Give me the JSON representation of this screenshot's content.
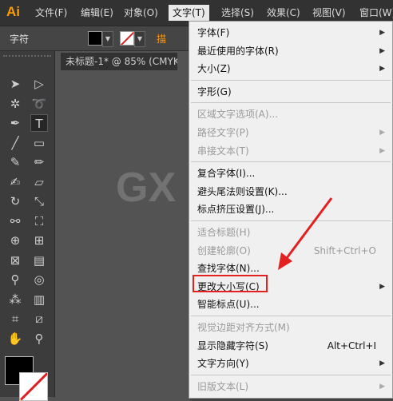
{
  "app": {
    "logo": "Ai"
  },
  "menubar": [
    {
      "label": "文件(F)",
      "active": false
    },
    {
      "label": "编辑(E)",
      "active": false
    },
    {
      "label": "对象(O)",
      "active": false
    },
    {
      "label": "文字(T)",
      "active": true
    },
    {
      "label": "选择(S)",
      "active": false
    },
    {
      "label": "效果(C)",
      "active": false
    },
    {
      "label": "视图(V)",
      "active": false
    },
    {
      "label": "窗口(W)",
      "active": false
    }
  ],
  "control_bar": {
    "label": "字符",
    "extra": "描"
  },
  "document": {
    "tab_title": "未标题-1* @ 85% (CMYK"
  },
  "watermark": "GX",
  "colors": {
    "accent": "#ff9a00",
    "highlight": "#e32121",
    "menu_bg": "#f0f0f0"
  },
  "type_menu": {
    "items": [
      {
        "label": "字体(F)",
        "shortcut": "",
        "submenu": true,
        "disabled": false,
        "sep_before": false
      },
      {
        "label": "最近使用的字体(R)",
        "shortcut": "",
        "submenu": true,
        "disabled": false,
        "sep_before": false
      },
      {
        "label": "大小(Z)",
        "shortcut": "",
        "submenu": true,
        "disabled": false,
        "sep_before": false
      },
      {
        "label": "字形(G)",
        "shortcut": "",
        "submenu": false,
        "disabled": false,
        "sep_before": true
      },
      {
        "label": "区域文字选项(A)...",
        "shortcut": "",
        "submenu": false,
        "disabled": true,
        "sep_before": true
      },
      {
        "label": "路径文字(P)",
        "shortcut": "",
        "submenu": true,
        "disabled": true,
        "sep_before": false
      },
      {
        "label": "串接文本(T)",
        "shortcut": "",
        "submenu": true,
        "disabled": true,
        "sep_before": false
      },
      {
        "label": "复合字体(I)...",
        "shortcut": "",
        "submenu": false,
        "disabled": false,
        "sep_before": true
      },
      {
        "label": "避头尾法则设置(K)...",
        "shortcut": "",
        "submenu": false,
        "disabled": false,
        "sep_before": false
      },
      {
        "label": "标点挤压设置(J)...",
        "shortcut": "",
        "submenu": false,
        "disabled": false,
        "sep_before": false
      },
      {
        "label": "适合标题(H)",
        "shortcut": "",
        "submenu": false,
        "disabled": true,
        "sep_before": true
      },
      {
        "label": "创建轮廓(O)",
        "shortcut": "Shift+Ctrl+O",
        "submenu": false,
        "disabled": true,
        "sep_before": false
      },
      {
        "label": "查找字体(N)...",
        "shortcut": "",
        "submenu": false,
        "disabled": false,
        "sep_before": false
      },
      {
        "label": "更改大小写(C)",
        "shortcut": "",
        "submenu": true,
        "disabled": false,
        "sep_before": false
      },
      {
        "label": "智能标点(U)...",
        "shortcut": "",
        "submenu": false,
        "disabled": false,
        "sep_before": false
      },
      {
        "label": "视觉边距对齐方式(M)",
        "shortcut": "",
        "submenu": false,
        "disabled": true,
        "sep_before": true
      },
      {
        "label": "显示隐藏字符(S)",
        "shortcut": "Alt+Ctrl+I",
        "submenu": false,
        "disabled": false,
        "sep_before": false
      },
      {
        "label": "文字方向(Y)",
        "shortcut": "",
        "submenu": true,
        "disabled": false,
        "sep_before": false
      },
      {
        "label": "旧版文本(L)",
        "shortcut": "",
        "submenu": true,
        "disabled": true,
        "sep_before": true
      }
    ]
  },
  "tools": [
    {
      "icon": "selection-tool-icon",
      "glyph": "➤",
      "selected": false
    },
    {
      "icon": "direct-selection-tool-icon",
      "glyph": "▷",
      "selected": false
    },
    {
      "icon": "magic-wand-tool-icon",
      "glyph": "✲",
      "selected": false
    },
    {
      "icon": "lasso-tool-icon",
      "glyph": "➰",
      "selected": false
    },
    {
      "icon": "pen-tool-icon",
      "glyph": "✒",
      "selected": false
    },
    {
      "icon": "type-tool-icon",
      "glyph": "T",
      "selected": true
    },
    {
      "icon": "line-tool-icon",
      "glyph": "╱",
      "selected": false
    },
    {
      "icon": "rectangle-tool-icon",
      "glyph": "▭",
      "selected": false
    },
    {
      "icon": "paintbrush-tool-icon",
      "glyph": "✎",
      "selected": false
    },
    {
      "icon": "pencil-tool-icon",
      "glyph": "✏",
      "selected": false
    },
    {
      "icon": "blob-brush-tool-icon",
      "glyph": "✍",
      "selected": false
    },
    {
      "icon": "eraser-tool-icon",
      "glyph": "▱",
      "selected": false
    },
    {
      "icon": "rotate-tool-icon",
      "glyph": "↻",
      "selected": false
    },
    {
      "icon": "scale-tool-icon",
      "glyph": "⤡",
      "selected": false
    },
    {
      "icon": "width-tool-icon",
      "glyph": "⚯",
      "selected": false
    },
    {
      "icon": "free-transform-tool-icon",
      "glyph": "⛶",
      "selected": false
    },
    {
      "icon": "shape-builder-tool-icon",
      "glyph": "⊕",
      "selected": false
    },
    {
      "icon": "perspective-grid-tool-icon",
      "glyph": "⊞",
      "selected": false
    },
    {
      "icon": "mesh-tool-icon",
      "glyph": "⊠",
      "selected": false
    },
    {
      "icon": "gradient-tool-icon",
      "glyph": "▤",
      "selected": false
    },
    {
      "icon": "eyedropper-tool-icon",
      "glyph": "⚲",
      "selected": false
    },
    {
      "icon": "blend-tool-icon",
      "glyph": "◎",
      "selected": false
    },
    {
      "icon": "symbol-sprayer-tool-icon",
      "glyph": "⁂",
      "selected": false
    },
    {
      "icon": "column-graph-tool-icon",
      "glyph": "▥",
      "selected": false
    },
    {
      "icon": "artboard-tool-icon",
      "glyph": "⌗",
      "selected": false
    },
    {
      "icon": "slice-tool-icon",
      "glyph": "⧄",
      "selected": false
    },
    {
      "icon": "hand-tool-icon",
      "glyph": "✋",
      "selected": false
    },
    {
      "icon": "zoom-tool-icon",
      "glyph": "⚲",
      "selected": false
    }
  ]
}
